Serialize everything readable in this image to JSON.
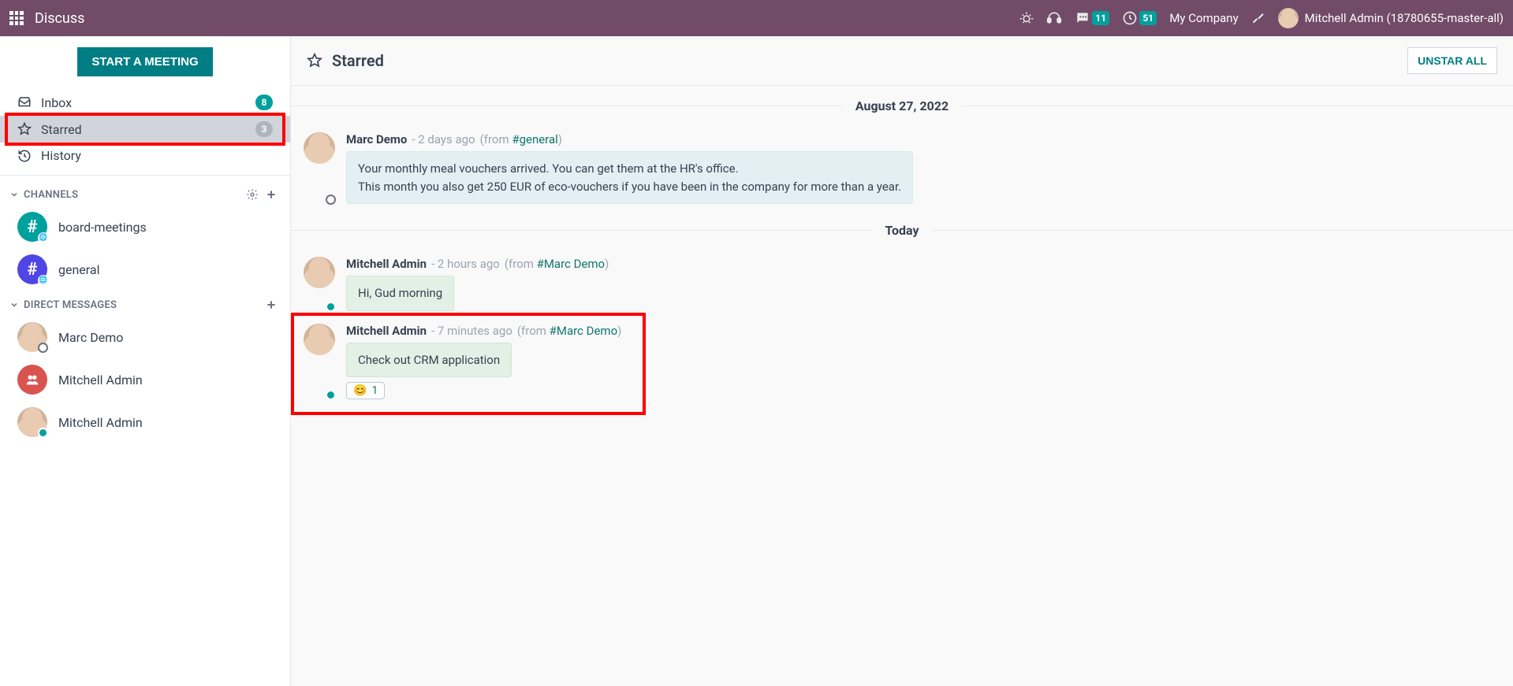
{
  "top": {
    "app_title": "Discuss",
    "chat_badge": "11",
    "clock_badge": "51",
    "company": "My Company",
    "user_name": "Mitchell Admin (18780655-master-all)"
  },
  "sidebar": {
    "start_meeting": "START A MEETING",
    "nav": {
      "inbox": {
        "label": "Inbox",
        "count": "8"
      },
      "starred": {
        "label": "Starred",
        "count": "3"
      },
      "history": {
        "label": "History"
      }
    },
    "channels_header": "CHANNELS",
    "channels": [
      {
        "name": "board-meetings",
        "color": "ch-green"
      },
      {
        "name": "general",
        "color": "ch-blue"
      }
    ],
    "dm_header": "DIRECT MESSAGES",
    "dms": [
      {
        "name": "Marc Demo",
        "presence": "away"
      },
      {
        "name": "Mitchell Admin",
        "presence": "online",
        "icon": "group"
      },
      {
        "name": "Mitchell Admin",
        "presence": "online"
      }
    ]
  },
  "main": {
    "title": "Starred",
    "unstar_all": "UNSTAR ALL",
    "sep1": "August 27, 2022",
    "sep2": "Today",
    "msgs": [
      {
        "author": "Marc Demo",
        "time": "- 2 days ago",
        "from_prefix": "(from ",
        "from_channel": "#general",
        "from_suffix": ")",
        "bubble_class": "blue",
        "lines": [
          "Your monthly meal vouchers arrived. You can get them at the HR's office.",
          "This month you also get 250 EUR of eco-vouchers if you have been in the company for more than a year."
        ],
        "presence": "away"
      },
      {
        "author": "Mitchell Admin",
        "time": "- 2 hours ago",
        "from_prefix": "(from ",
        "from_channel": "#Marc Demo",
        "from_suffix": ")",
        "bubble_class": "green",
        "lines": [
          "Hi, Gud morning"
        ],
        "presence": "online"
      },
      {
        "author": "Mitchell Admin",
        "time": "- 7 minutes ago",
        "from_prefix": "(from ",
        "from_channel": "#Marc Demo",
        "from_suffix": ")",
        "bubble_class": "green",
        "lines": [
          "Check out CRM application"
        ],
        "reaction": {
          "emoji": "😊",
          "count": "1"
        },
        "presence": "online"
      }
    ]
  }
}
